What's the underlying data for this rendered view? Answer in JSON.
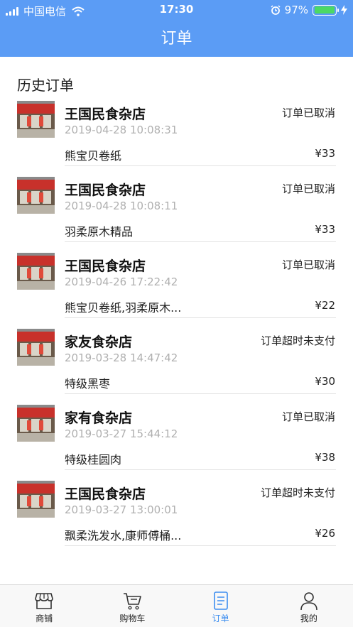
{
  "status_bar": {
    "carrier": "中国电信",
    "time": "17:30",
    "battery": "97%",
    "battery_level": 0.97
  },
  "header": {
    "title": "订单"
  },
  "section": {
    "title": "历史订单"
  },
  "orders": [
    {
      "shop": "王国民食杂店",
      "status": "订单已取消",
      "time": "2019-04-28 10:08:31",
      "items": "熊宝贝卷纸",
      "price": "¥33"
    },
    {
      "shop": "王国民食杂店",
      "status": "订单已取消",
      "time": "2019-04-28 10:08:11",
      "items": "羽柔原木精品",
      "price": "¥33"
    },
    {
      "shop": "王国民食杂店",
      "status": "订单已取消",
      "time": "2019-04-26 17:22:42",
      "items": "熊宝贝卷纸,羽柔原木...",
      "price": "¥22"
    },
    {
      "shop": "家友食杂店",
      "status": "订单超时未支付",
      "time": "2019-03-28 14:47:42",
      "items": "特级黑枣",
      "price": "¥30"
    },
    {
      "shop": "家有食杂店",
      "status": "订单已取消",
      "time": "2019-03-27 15:44:12",
      "items": "特级桂圆肉",
      "price": "¥38"
    },
    {
      "shop": "王国民食杂店",
      "status": "订单超时未支付",
      "time": "2019-03-27 13:00:01",
      "items": "飘柔洗发水,康师傅桶...",
      "price": "¥26"
    }
  ],
  "tabbar": {
    "tabs": [
      {
        "label": "商铺",
        "icon": "store-icon"
      },
      {
        "label": "购物车",
        "icon": "cart-icon"
      },
      {
        "label": "订单",
        "icon": "orders-icon",
        "active": true
      },
      {
        "label": "我的",
        "icon": "profile-icon"
      }
    ]
  },
  "colors": {
    "header_bg": "#5b9cf5",
    "active_tab": "#3d8ef0",
    "battery": "#4cd964"
  }
}
